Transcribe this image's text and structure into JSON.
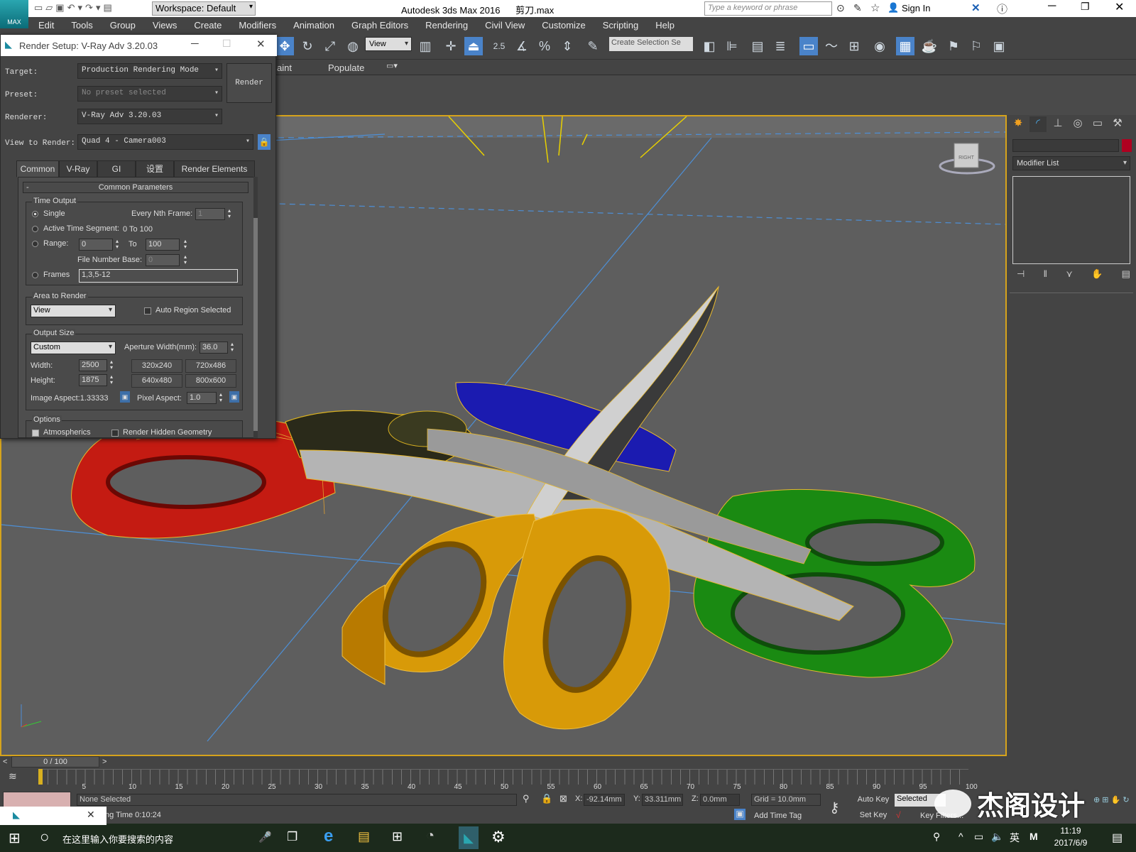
{
  "app": {
    "workspace_label": "Workspace: Default",
    "window_title": "Autodesk 3ds Max 2016",
    "file_name": "剪刀.max",
    "search_placeholder": "Type a keyword or phrase",
    "sign_in": "Sign In",
    "logo_text": "MAX"
  },
  "menu": [
    "Edit",
    "Tools",
    "Group",
    "Views",
    "Create",
    "Modifiers",
    "Animation",
    "Graph Editors",
    "Rendering",
    "Civil View",
    "Customize",
    "Scripting",
    "Help"
  ],
  "toolbar": {
    "view_dropdown": "View",
    "snap_value": "2.5",
    "selection_set_placeholder": "Create Selection Se"
  },
  "ribbon": {
    "items": [
      "aint",
      "Populate"
    ]
  },
  "render_setup": {
    "title": "Render Setup: V-Ray Adv 3.20.03",
    "target_label": "Target:",
    "target_value": "Production Rendering Mode",
    "preset_label": "Preset:",
    "preset_value": "No preset selected",
    "renderer_label": "Renderer:",
    "renderer_value": "V-Ray Adv 3.20.03",
    "view_label": "View to Render:",
    "view_value": "Quad 4 - Camera003",
    "render_button": "Render",
    "tabs": [
      "Common",
      "V-Ray",
      "GI",
      "设置",
      "Render Elements"
    ],
    "rollout_title": "Common Parameters",
    "rollout_toggle": "-",
    "time_output": {
      "title": "Time Output",
      "single": "Single",
      "every_nth_label": "Every Nth Frame:",
      "every_nth_value": "1",
      "active_segment": "Active Time Segment:",
      "active_segment_value": "0 To 100",
      "range": "Range:",
      "range_from": "0",
      "range_to_label": "To",
      "range_to": "100",
      "file_number_base_label": "File Number Base:",
      "file_number_base": "0",
      "frames": "Frames",
      "frames_value": "1,3,5-12"
    },
    "area": {
      "title": "Area to Render",
      "value": "View",
      "auto_region": "Auto Region Selected"
    },
    "output_size": {
      "title": "Output Size",
      "preset": "Custom",
      "aperture_label": "Aperture Width(mm):",
      "aperture_value": "36.0",
      "width_label": "Width:",
      "width_value": "2500",
      "height_label": "Height:",
      "height_value": "1875",
      "presets": [
        "320x240",
        "720x486",
        "640x480",
        "800x600"
      ],
      "image_aspect": "Image Aspect:1.33333",
      "pixel_aspect_label": "Pixel Aspect:",
      "pixel_aspect_value": "1.0"
    },
    "options": {
      "title": "Options",
      "atmospherics": "Atmospherics",
      "render_hidden": "Render Hidden Geometry"
    }
  },
  "command_panel": {
    "modifier_list": "Modifier List"
  },
  "viewcube": {
    "label": "RIGHT"
  },
  "timeline": {
    "frame_counter": "0 / 100",
    "ticks": [
      "5",
      "10",
      "15",
      "20",
      "25",
      "30",
      "35",
      "40",
      "45",
      "50",
      "55",
      "60",
      "65",
      "70",
      "75",
      "80",
      "85",
      "90",
      "95",
      "100"
    ]
  },
  "status": {
    "selection": "None Selected",
    "rendering_time": "ng Time  0:10:24",
    "x_label": "X:",
    "x_value": "-92.14mm",
    "y_label": "Y:",
    "y_value": "33.311mm",
    "z_label": "Z:",
    "z_value": "0.0mm",
    "grid": "Grid = 10.0mm",
    "add_time_tag": "Add Time Tag",
    "auto_key": "Auto Key",
    "auto_key_mode": "Selected",
    "set_key": "Set Key",
    "key_filters": "Key Filters..."
  },
  "taskbar": {
    "search_placeholder": "在这里输入你要搜索的内容",
    "time": "11:19",
    "date": "2017/6/9",
    "ime": "英"
  },
  "watermark": "杰阁设计",
  "colors": {
    "accent": "#4a83c9",
    "selection_outline": "#d6a31c",
    "handle_red": "#c41b12",
    "handle_yellow": "#d89a08",
    "handle_green": "#1a8a12",
    "handle_blue": "#1b1bb0"
  }
}
